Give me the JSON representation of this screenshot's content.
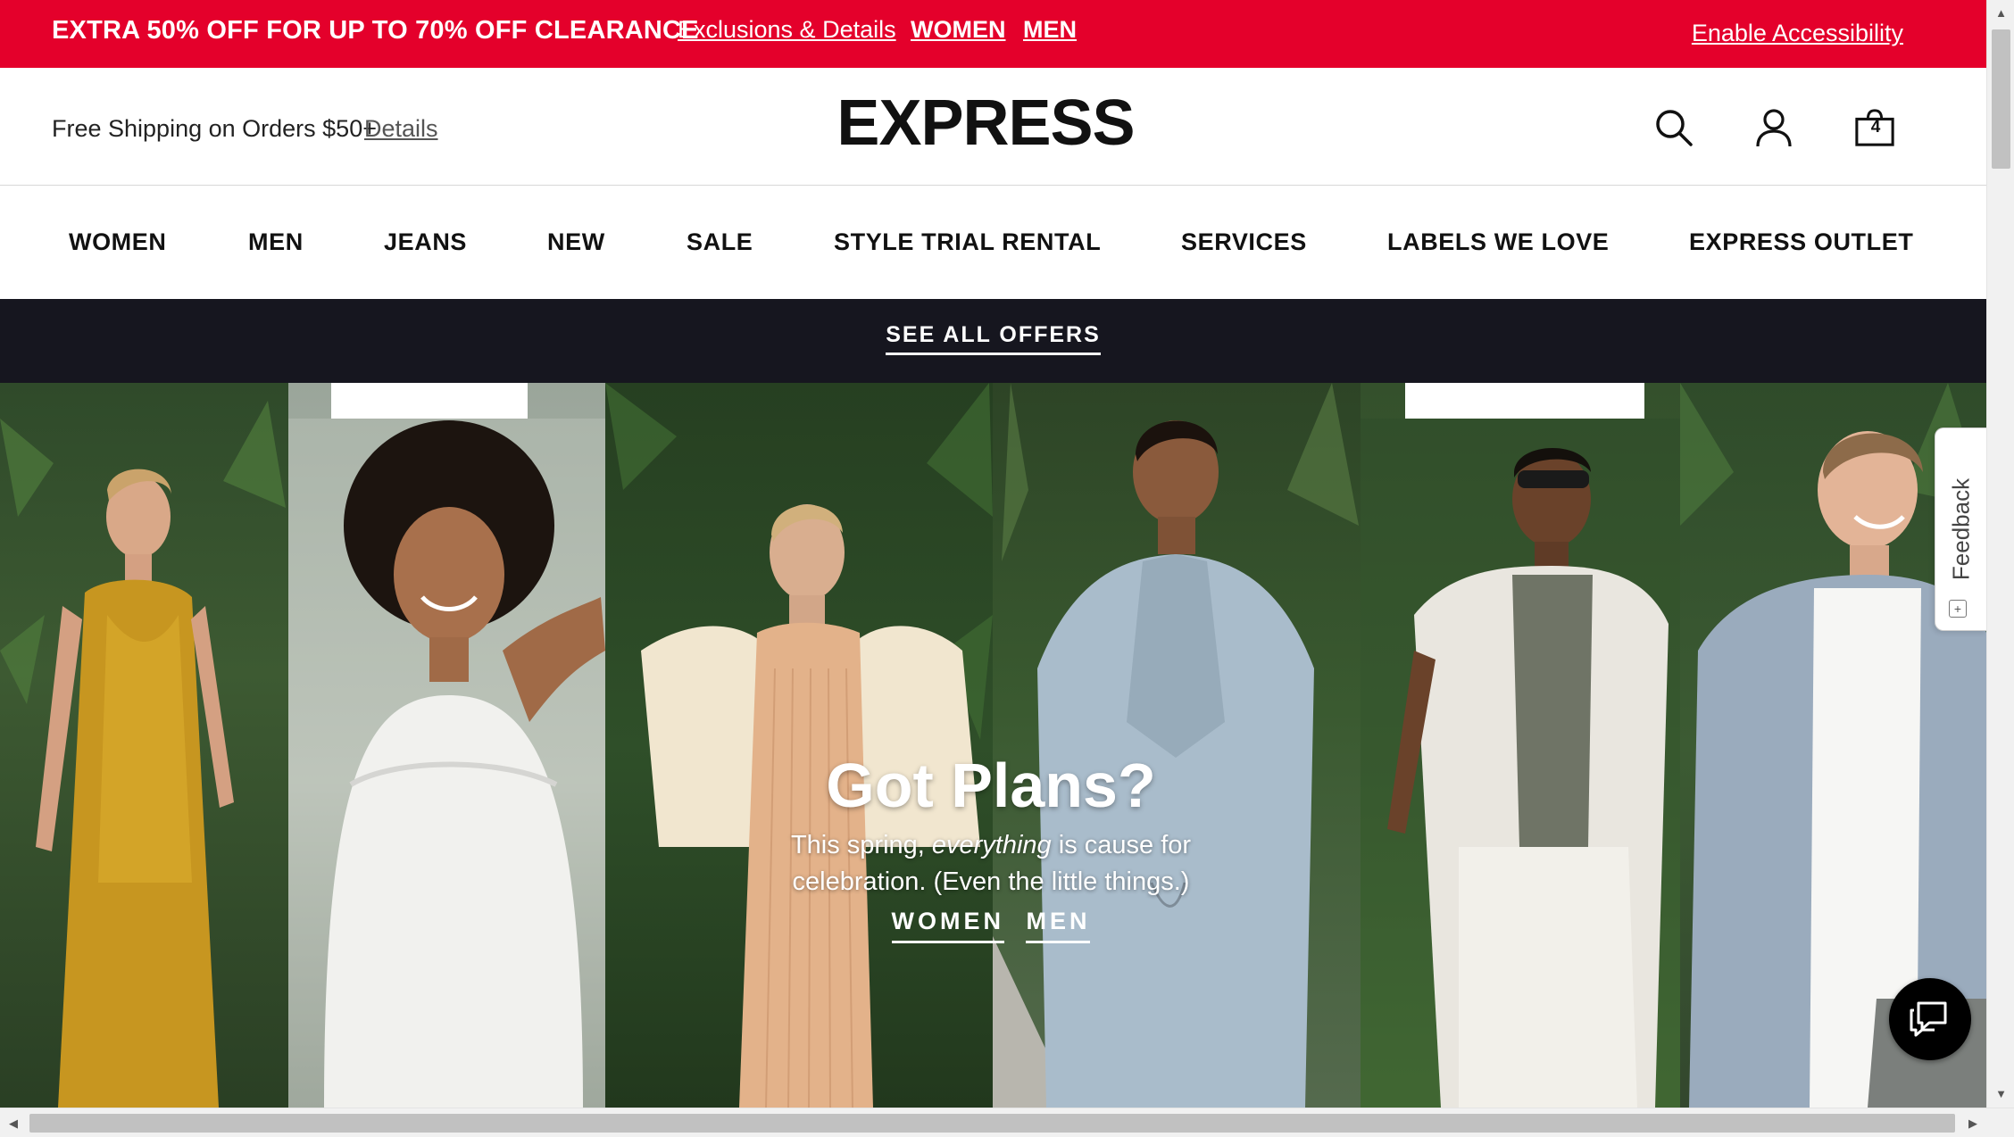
{
  "promo_banner": {
    "headline": "EXTRA 50% OFF FOR UP TO 70% OFF CLEARANCE",
    "details_link": "Exclusions & Details",
    "women_link": "WOMEN",
    "men_link": "MEN",
    "accessibility_link": "Enable Accessibility",
    "bg_color": "#e4002b"
  },
  "header": {
    "shipping_text": "Free Shipping on Orders $50+",
    "shipping_details_link": "Details",
    "logo": "EXPRESS",
    "bag_count": "4",
    "icons": [
      "search-icon",
      "account-icon",
      "shopping-bag-icon"
    ]
  },
  "nav": {
    "items": [
      "WOMEN",
      "MEN",
      "JEANS",
      "NEW",
      "SALE",
      "STYLE TRIAL RENTAL",
      "SERVICES",
      "LABELS WE LOVE",
      "EXPRESS OUTLET"
    ]
  },
  "offers_bar": {
    "link": "SEE ALL OFFERS",
    "bg_color": "#16161f"
  },
  "hero": {
    "title": "Got Plans?",
    "subtitle_before": "This spring, ",
    "subtitle_emphasis": "everything",
    "subtitle_after": " is cause for celebration. (Even the little things.)",
    "cta_women": "WOMEN",
    "cta_men": "MEN"
  },
  "feedback_tab": {
    "label": "Feedback",
    "plus": "+"
  },
  "chat": {
    "icon": "chat-bubble-icon"
  }
}
